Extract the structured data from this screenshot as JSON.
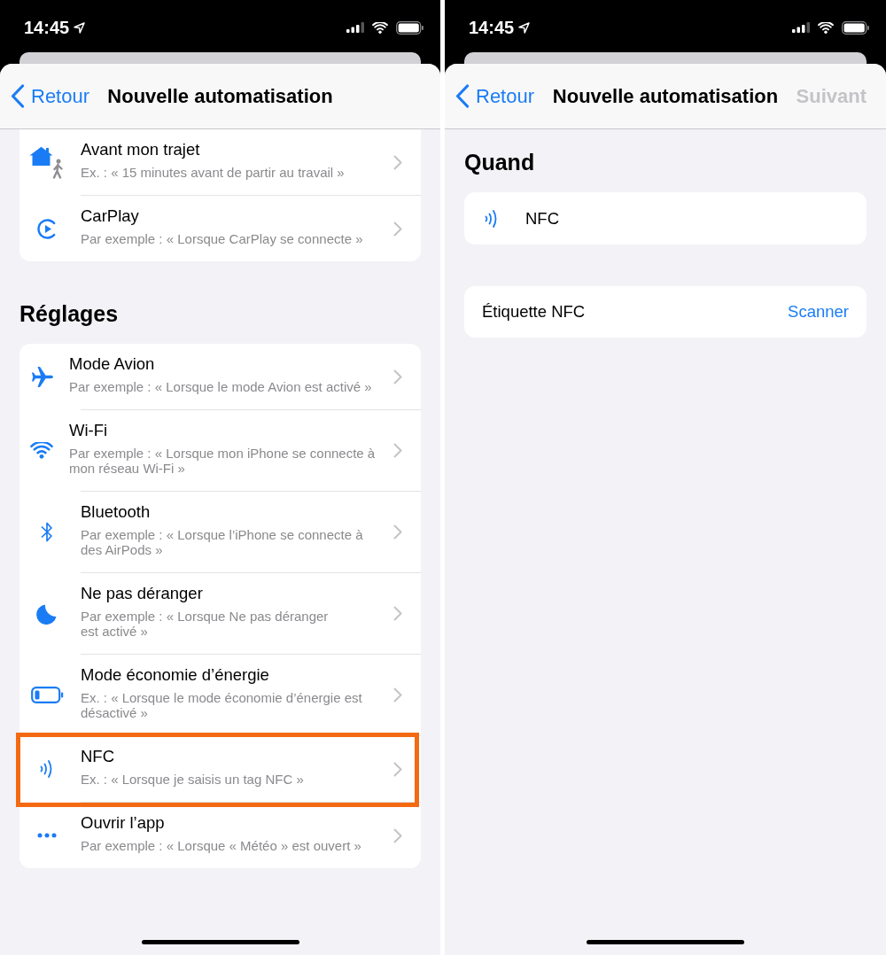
{
  "screens": [
    {
      "status_bar": {
        "time": "14:45"
      },
      "nav": {
        "back": "Retour",
        "title": "Nouvelle automatisation"
      },
      "sections": [
        {
          "kind": "menu",
          "rows": [
            {
              "kind": "trip",
              "title": "Avant mon trajet",
              "subtitle": "Ex. : « 15 minutes avant de partir au travail »",
              "highlighted": false
            },
            {
              "kind": "carplay",
              "title": "CarPlay",
              "subtitle": "Par exemple : « Lorsque CarPlay se connecte »",
              "highlighted": false
            }
          ]
        },
        {
          "kind": "menu",
          "title": "Réglages",
          "rows": [
            {
              "kind": "airplane",
              "title": "Mode Avion",
              "subtitle": "Par exemple : « Lorsque le mode Avion est activé »",
              "highlighted": false
            },
            {
              "kind": "wifi",
              "title": "Wi-Fi",
              "subtitle": "Par exemple : « Lorsque mon iPhone se connecte à\nmon réseau Wi-Fi »",
              "highlighted": false
            },
            {
              "kind": "bluetooth",
              "title": "Bluetooth",
              "subtitle": "Par exemple : « Lorsque l’iPhone se connecte à\ndes AirPods »",
              "highlighted": false
            },
            {
              "kind": "moon",
              "title": "Ne pas déranger",
              "subtitle": "Par exemple : « Lorsque Ne pas déranger\nest activé »",
              "highlighted": false
            },
            {
              "kind": "battery",
              "title": "Mode économie d’énergie",
              "subtitle": "Ex. : « Lorsque le mode économie d’énergie est\ndésactivé »",
              "highlighted": false
            },
            {
              "kind": "nfc",
              "title": "NFC",
              "subtitle": "Ex. : « Lorsque je saisis un tag NFC »",
              "highlighted": true
            },
            {
              "kind": "app",
              "title": "Ouvrir l’app",
              "subtitle": "Par exemple : « Lorsque « Météo » est ouvert »",
              "highlighted": false
            }
          ]
        }
      ]
    },
    {
      "status_bar": {
        "time": "14:45"
      },
      "nav": {
        "back": "Retour",
        "title": "Nouvelle automatisation",
        "action": {
          "label": "Suivant",
          "disabled": true
        }
      },
      "sections": [
        {
          "kind": "trigger",
          "title": "Quand",
          "rows": [
            {
              "kind": "nfc",
              "title": "NFC"
            }
          ]
        },
        {
          "kind": "field",
          "rows": [
            {
              "label": "Étiquette NFC",
              "action": "Scanner"
            }
          ]
        }
      ]
    }
  ]
}
